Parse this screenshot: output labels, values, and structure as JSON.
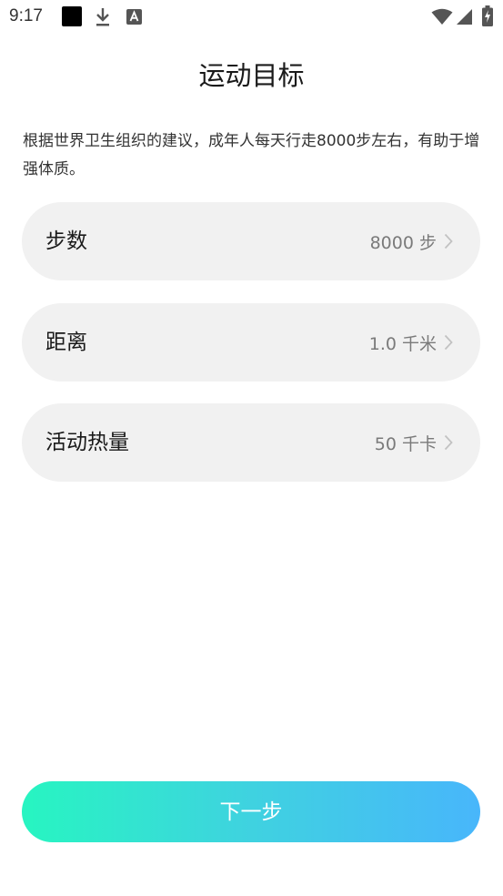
{
  "status_bar": {
    "time": "9:17",
    "icons": [
      "app-notification-square",
      "download-icon",
      "text-app-icon",
      "wifi-icon",
      "cellular-signal-icon",
      "battery-charging-icon"
    ]
  },
  "page": {
    "title": "运动目标",
    "intro": "根据世界卫生组织的建议，成年人每天行走8000步左右，有助于增强体质。"
  },
  "goals": [
    {
      "label": "步数",
      "value": "8000 步"
    },
    {
      "label": "距离",
      "value": "1.0 千米"
    },
    {
      "label": "活动热量",
      "value": "50 千卡"
    }
  ],
  "next_button": {
    "label": "下一步",
    "gradient_start": "#27f5c1",
    "gradient_end": "#48b6fb"
  },
  "colors": {
    "card_background": "#f1f1f1",
    "value_text": "#7a7a7a",
    "chevron": "#c2c2c2"
  }
}
